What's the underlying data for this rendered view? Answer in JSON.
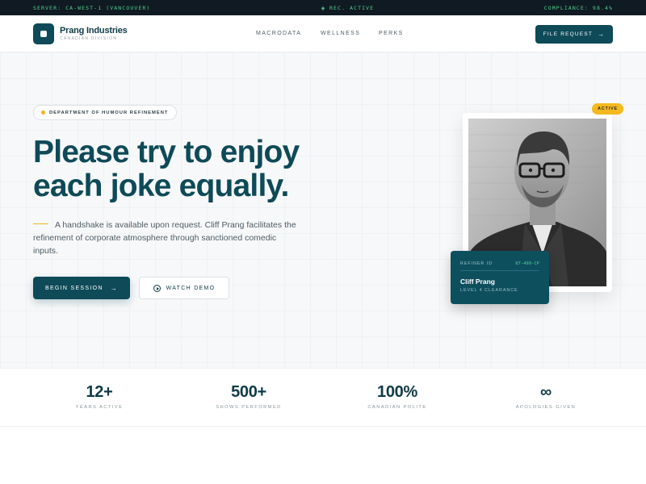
{
  "status_bar": {
    "server": "SERVER: CA-WEST-1 (VANCOUVER)",
    "mid": "◉ REC. ACTIVE",
    "compliance": "COMPLIANCE: 98.4%"
  },
  "header": {
    "brand_name": "Prang Industries",
    "brand_sub": "CANADIAN DIVISION",
    "nav": [
      "MACRODATA",
      "WELLNESS",
      "PERKS"
    ],
    "cta_label": "FILE REQUEST",
    "cta_icon": "arrow-right-icon"
  },
  "hero": {
    "pill_label": "DEPARTMENT OF HUMOUR REFINEMENT",
    "headline_line1": "Please try to enjoy",
    "headline_line2": "each joke equally.",
    "body": "A handshake is available upon request. Cliff Prang facilitates the refinement of corporate atmosphere through sanctioned comedic inputs.",
    "primary_button": "BEGIN SESSION",
    "secondary_button": "WATCH DEMO",
    "accent_color": "#0e4a58",
    "highlight_color": "#f2b31a"
  },
  "profile": {
    "badge": "ACTIVE",
    "id_label": "REFINER ID",
    "id_value": "87-499-CP",
    "name": "Cliff Prang",
    "clearance": "LEVEL 4 CLEARANCE"
  },
  "stats": [
    {
      "value": "12+",
      "label": "YEARS ACTIVE"
    },
    {
      "value": "500+",
      "label": "SHOWS PERFORMED"
    },
    {
      "value": "100%",
      "label": "CANADIAN POLITE"
    },
    {
      "value": "∞",
      "label": "APOLOGIES GIVEN"
    }
  ]
}
